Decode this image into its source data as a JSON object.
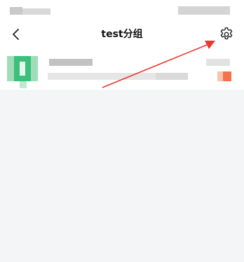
{
  "nav": {
    "title": "test分组",
    "back_icon": "chevron-left-icon",
    "settings_icon": "gear-icon"
  },
  "colors": {
    "avatar_green": "#33bb77",
    "annotation_arrow": "#e8392f",
    "badge_orange": "#f4724a"
  }
}
